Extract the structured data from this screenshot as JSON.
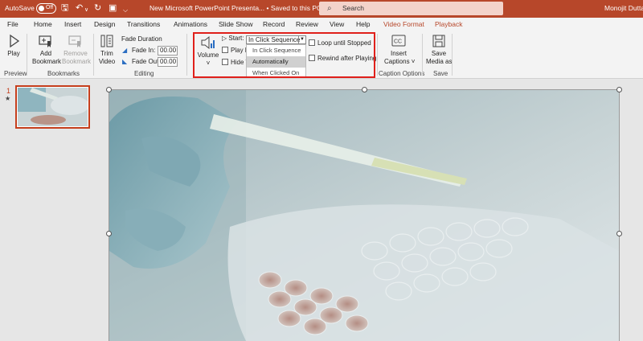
{
  "titlebar": {
    "autosave_label": "AutoSave",
    "autosave_state": "Off",
    "doc_title": "New Microsoft PowerPoint Presenta... • Saved to this PC ∨",
    "search_placeholder": "Search",
    "user_name": "Monojit Dutta"
  },
  "tabs": [
    "File",
    "Home",
    "Insert",
    "Design",
    "Transitions",
    "Animations",
    "Slide Show",
    "Record",
    "Review",
    "View",
    "Help",
    "Video Format",
    "Playback"
  ],
  "ribbon": {
    "preview": {
      "play": "Play",
      "group": "Preview"
    },
    "bookmarks": {
      "add_line1": "Add",
      "add_line2": "Bookmark",
      "remove_line1": "Remove",
      "remove_line2": "Bookmark",
      "group": "Bookmarks"
    },
    "editing": {
      "trim_line1": "Trim",
      "trim_line2": "Video",
      "fade_duration": "Fade Duration",
      "fade_in_label": "Fade In:",
      "fade_in_value": "00.00",
      "fade_out_label": "Fade Out:",
      "fade_out_value": "00.00",
      "group": "Editing"
    },
    "video_options": {
      "volume": "Volume",
      "start_label": "Start:",
      "start_value": "In Click Sequence",
      "play_full": "Play Fu",
      "hide_while": "Hide W",
      "loop": "Loop until Stopped",
      "rewind": "Rewind after Playing",
      "dropdown_options": [
        "In Click Sequence",
        "Automatically",
        "When Clicked On"
      ],
      "dropdown_selected": "Automatically"
    },
    "caption": {
      "insert_line1": "Insert",
      "insert_line2": "Captions ˅",
      "group": "Caption Options"
    },
    "save": {
      "save_line1": "Save",
      "save_line2": "Media as",
      "group": "Save"
    }
  },
  "slides": {
    "number": "1",
    "star": "★"
  },
  "colors": {
    "accent": "#b7472a",
    "highlight": "#e0201b"
  }
}
